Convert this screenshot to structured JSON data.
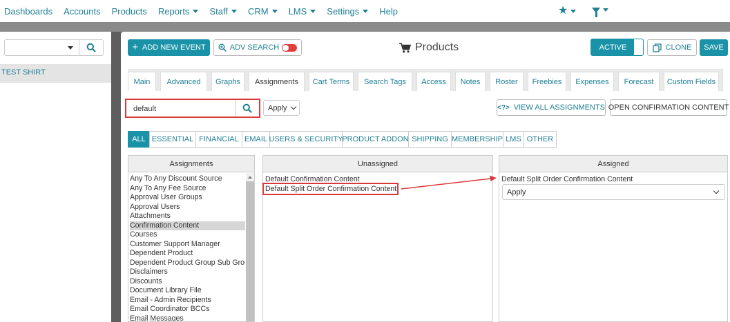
{
  "nav": {
    "items": [
      {
        "label": "Dashboards",
        "dropdown": false
      },
      {
        "label": "Accounts",
        "dropdown": false
      },
      {
        "label": "Products",
        "dropdown": false
      },
      {
        "label": "Reports",
        "dropdown": true
      },
      {
        "label": "Staff",
        "dropdown": true
      },
      {
        "label": "CRM",
        "dropdown": true
      },
      {
        "label": "LMS",
        "dropdown": true
      },
      {
        "label": "Settings",
        "dropdown": true
      },
      {
        "label": "Help",
        "dropdown": false
      }
    ],
    "right_icons": [
      "star-icon",
      "funnel-icon"
    ]
  },
  "sidebar": {
    "search_value": "",
    "items": [
      "TEST SHIRT"
    ]
  },
  "toolbar": {
    "add_event_label": "ADD NEW EVENT",
    "adv_search_label": "ADV SEARCH",
    "page_title": "Products",
    "active_label": "ACTIVE",
    "clone_label": "CLONE",
    "save_label": "SAVE"
  },
  "tabs": [
    "Main",
    "Advanced",
    "Graphs",
    "Assignments",
    "Cart Terms",
    "Search Tags",
    "Access",
    "Notes",
    "Roster",
    "Freebies",
    "Expenses",
    "Forecast",
    "Custom Fields"
  ],
  "active_tab": "Assignments",
  "filter": {
    "search_value": "default",
    "apply_label": "Apply",
    "view_all_label": "VIEW ALL ASSIGNMENTS",
    "view_all_icon": "<?>",
    "open_confirmation_label": "OPEN CONFIRMATION CONTENT"
  },
  "categories": [
    "ALL",
    "ESSENTIAL",
    "FINANCIAL",
    "EMAIL",
    "USERS & SECURITY",
    "PRODUCT ADDON",
    "SHIPPING",
    "MEMBERSHIP",
    "LMS",
    "OTHER"
  ],
  "active_category": "ALL",
  "assignments": {
    "header": "Assignments",
    "items": [
      "Any To Any Discount Source",
      "Any To Any Fee Source",
      "Approval User Groups",
      "Approval Users",
      "Attachments",
      "Confirmation Content",
      "Courses",
      "Customer Support Manager",
      "Dependent Product",
      "Dependent Product Group Sub Group",
      "Disclaimers",
      "Discounts",
      "Document Library File",
      "Email - Admin Recipients",
      "Email Coordinator BCCs",
      "Email Messages"
    ],
    "selected": "Confirmation Content"
  },
  "unassigned": {
    "header": "Unassigned",
    "items": [
      "Default Confirmation Content",
      "Default Split Order Confirmation Content"
    ],
    "highlighted": "Default Split Order Confirmation Content"
  },
  "assigned": {
    "header": "Assigned",
    "items": [
      {
        "label": "Default Split Order Confirmation Content",
        "select_value": "Apply"
      }
    ]
  },
  "colors": {
    "accent": "#1a93a8",
    "link": "#1f7f95",
    "highlight_red": "#d9383a",
    "toggle_off": "#e43d3d"
  }
}
